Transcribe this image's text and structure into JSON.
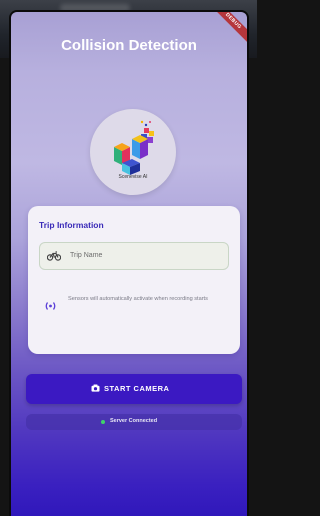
{
  "app": {
    "title": "Collision Detection",
    "debug_banner": "DEBUG"
  },
  "logo": {
    "caption": "Scenevise AI"
  },
  "trip_card": {
    "title": "Trip Information",
    "trip_name_placeholder": "Trip Name",
    "sensor_note": "Sensors will automatically activate when recording starts"
  },
  "actions": {
    "start_camera_label": "START CAMERA"
  },
  "status": {
    "text": "Server Connected",
    "color": "#3fd46a"
  },
  "colors": {
    "accent": "#3b19c2",
    "title_text": "#3a2bb8"
  },
  "icons": {
    "trip_input": "bike-icon",
    "sensor": "sensor-icon",
    "button": "camera-icon"
  }
}
